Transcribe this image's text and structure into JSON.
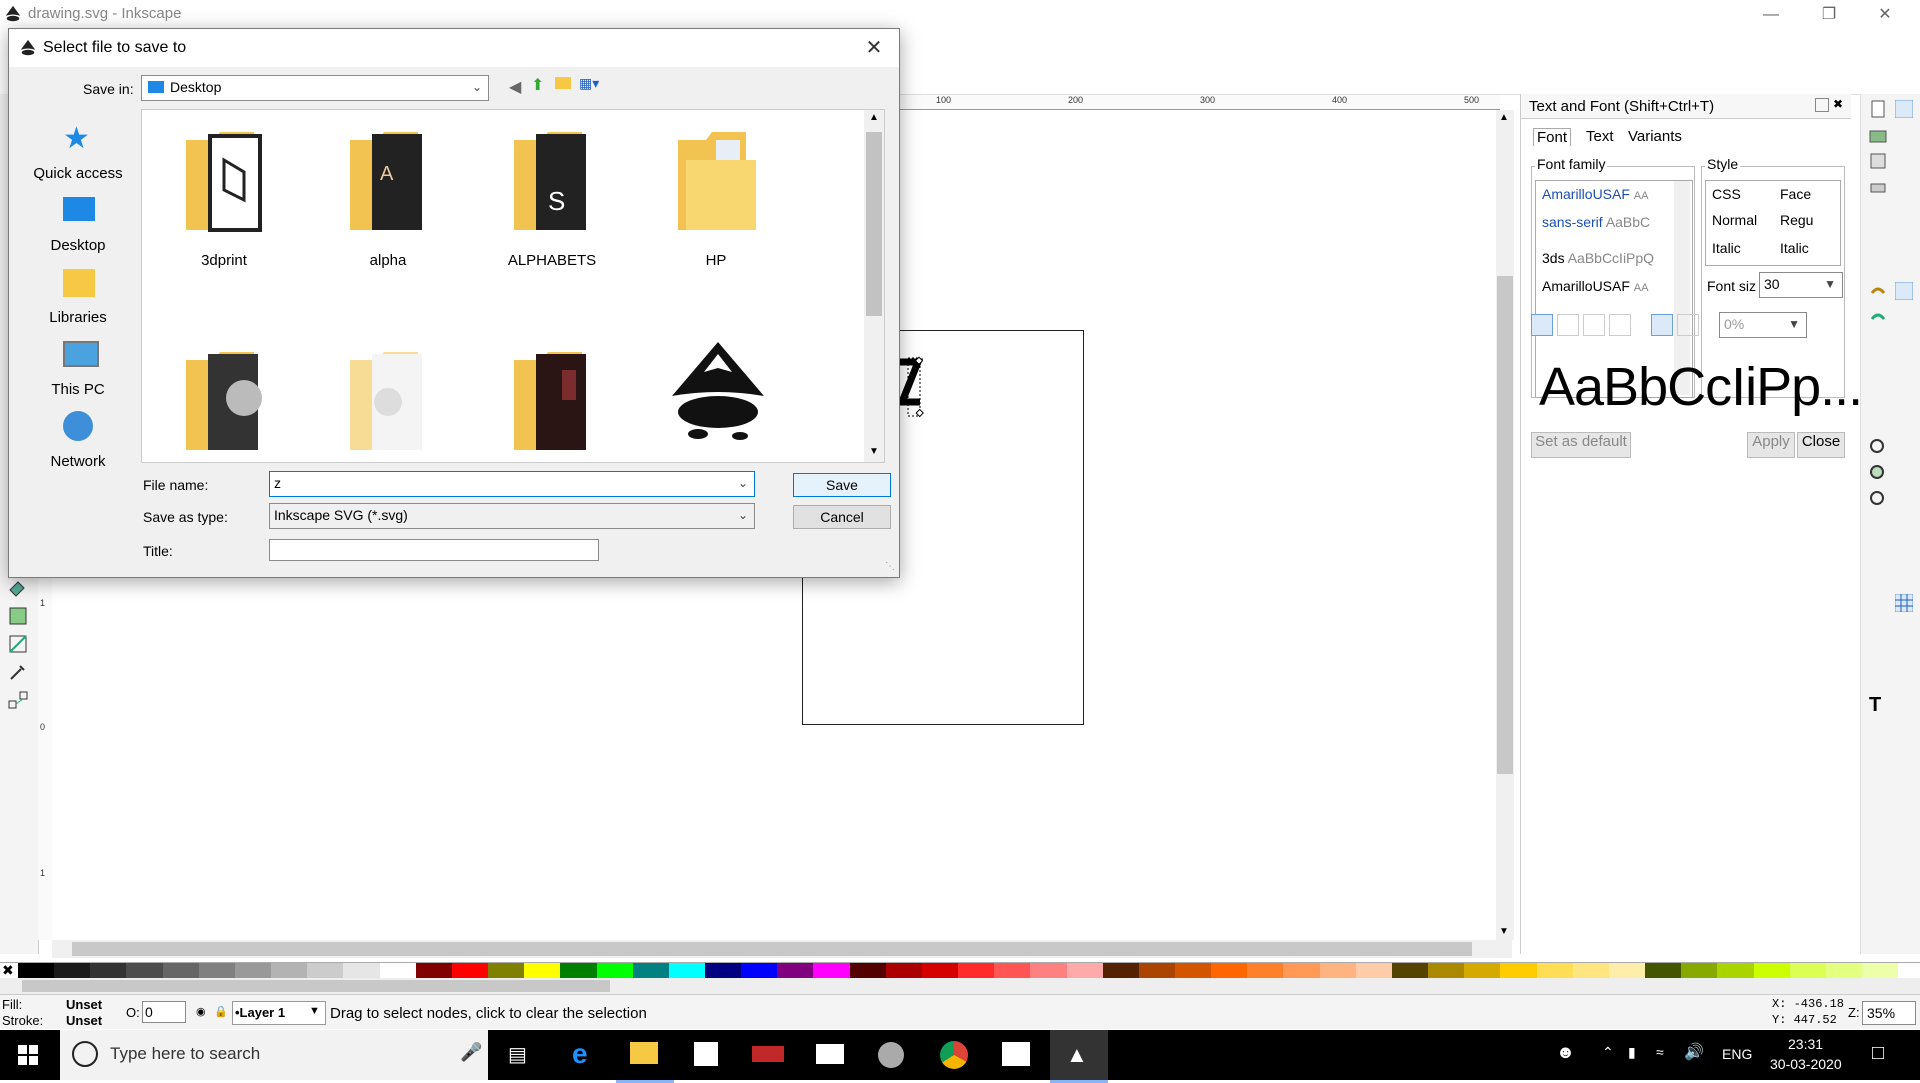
{
  "window": {
    "title": "drawing.svg - Inkscape",
    "minimize_icon": "minimize-icon",
    "maximize_icon": "restore-icon",
    "close_icon": "close-icon"
  },
  "rulers": {
    "h_ticks": [
      "100",
      "200",
      "300",
      "400",
      "500"
    ],
    "v_ticks": [
      "1",
      "0",
      "1"
    ]
  },
  "text_font_panel": {
    "title": "Text and Font (Shift+Ctrl+T)",
    "tabs": [
      "Font",
      "Text",
      "Variants"
    ],
    "font_family_label": "Font family",
    "font_families": [
      {
        "name": "AmarilloUSAF",
        "sample": "AA"
      },
      {
        "name": "sans-serif",
        "sample": "AaBbC"
      },
      {
        "name": "3ds",
        "sample": "AaBbCcIiPpQ"
      },
      {
        "name": "AmarilloUSAF",
        "sample": "AA"
      }
    ],
    "style_label": "Style",
    "styles": [
      {
        "css": "CSS",
        "face": "Face"
      },
      {
        "css": "Normal",
        "face": "Regu"
      },
      {
        "css": "Italic",
        "face": "Italic"
      }
    ],
    "font_size_label": "Font siz",
    "font_size": "30",
    "spacing_value": "0%",
    "preview_text": "AaBbCcIiPp...",
    "set_default_label": "Set as default",
    "apply_label": "Apply",
    "close_label": "Close"
  },
  "status": {
    "fill_label": "Fill:",
    "fill_value": "Unset",
    "stroke_label": "Stroke:",
    "stroke_value": "Unset",
    "opacity_label": "O:",
    "opacity_value": "0",
    "layer": "•Layer 1",
    "message": "Drag to select nodes, click to clear the selection",
    "x_coord": "X: -436.18",
    "y_coord": "Y:  447.52",
    "zoom_label": "Z:",
    "zoom_value": "35%"
  },
  "palette_colors": [
    "#000000",
    "#1a1a1a",
    "#333333",
    "#4d4d4d",
    "#666666",
    "#808080",
    "#999999",
    "#b3b3b3",
    "#cccccc",
    "#e6e6e6",
    "#ffffff",
    "#800000",
    "#ff0000",
    "#808000",
    "#ffff00",
    "#008000",
    "#00ff00",
    "#008080",
    "#00ffff",
    "#000080",
    "#0000ff",
    "#800080",
    "#ff00ff",
    "#550000",
    "#aa0000",
    "#d40000",
    "#ff2a2a",
    "#ff5555",
    "#ff8080",
    "#ffaaaa",
    "#552200",
    "#aa4400",
    "#d45500",
    "#ff6600",
    "#ff7f2a",
    "#ff9955",
    "#ffb380",
    "#ffccaa",
    "#554400",
    "#aa8800",
    "#d4aa00",
    "#ffcc00",
    "#ffdd55",
    "#ffe680",
    "#ffeeaa",
    "#445500",
    "#88aa00",
    "#aad400",
    "#ccff00",
    "#ddff55",
    "#e5ff80",
    "#eeffaa"
  ],
  "taskbar": {
    "search_placeholder": "Type here to search",
    "language": "ENG",
    "time": "23:31",
    "date": "30-03-2020"
  },
  "dialog": {
    "title": "Select file to save to",
    "save_in_label": "Save in:",
    "save_in_value": "Desktop",
    "places": [
      "Quick access",
      "Desktop",
      "Libraries",
      "This PC",
      "Network"
    ],
    "files": [
      "3dprint",
      "alpha",
      "ALPHABETS",
      "HP",
      "",
      "",
      "",
      ""
    ],
    "file_name_label": "File name:",
    "file_name_value": "z",
    "save_as_type_label": "Save as type:",
    "save_as_type_value": "Inkscape SVG (*.svg)",
    "title_label": "Title:",
    "title_value": "",
    "save_label": "Save",
    "cancel_label": "Cancel"
  }
}
